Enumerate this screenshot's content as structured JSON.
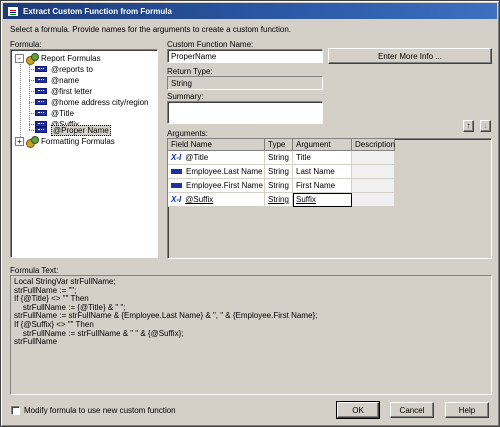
{
  "window": {
    "title": "Extract Custom Function from Formula"
  },
  "instructions": "Select a formula.  Provide names for the arguments to create a custom function.",
  "formula_label": "Formula:",
  "tree": {
    "root1": "Report Formulas",
    "items": [
      "@reports to",
      "@name",
      "@first letter",
      "@home address city/region",
      "@Title",
      "@Suffix",
      "@Proper Name"
    ],
    "root2": "Formatting Formulas"
  },
  "custom_function": {
    "label": "Custom Function Name:",
    "value": "ProperName"
  },
  "enter_more_info": "Enter More Info ...",
  "return_type": {
    "label": "Return Type:",
    "value": "String"
  },
  "summary": {
    "label": "Summary:",
    "value": ""
  },
  "arguments": {
    "label": "Arguments:",
    "columns": [
      "Field Name",
      "Type",
      "Argument Name",
      "Description"
    ],
    "rows": [
      {
        "icon": "x-icon",
        "field": "@Title",
        "type": "String",
        "arg": "Title",
        "desc": ""
      },
      {
        "icon": "field-icon",
        "field": "Employee.Last Name",
        "type": "String",
        "arg": "Last Name",
        "desc": ""
      },
      {
        "icon": "field-icon",
        "field": "Employee.First Name",
        "type": "String",
        "arg": "First Name",
        "desc": ""
      },
      {
        "icon": "x-icon",
        "field": "@Suffix",
        "type": "String",
        "arg": "Suffix",
        "desc": ""
      }
    ]
  },
  "formula_text": {
    "label": "Formula Text:",
    "lines": [
      "Local StringVar strFullName;",
      "strFullName := \"\";",
      "If {@Title} <> \"\" Then",
      "    strFullName := {@Title} & \" \";",
      "strFullName := strFullName & {Employee.Last Name} & \", \" & {Employee.First Name};",
      "If {@Suffix} <> \"\" Then",
      "    strFullName := strFullName & \" \" & {@Suffix};",
      "strFullName"
    ]
  },
  "modify_checkbox": {
    "label": "Modify formula to use new custom function",
    "checked": false
  },
  "buttons": {
    "ok": "OK",
    "cancel": "Cancel",
    "help": "Help"
  },
  "arrows": {
    "up": "↑",
    "down": "↓",
    "expand": "-",
    "collapsed": "+"
  }
}
